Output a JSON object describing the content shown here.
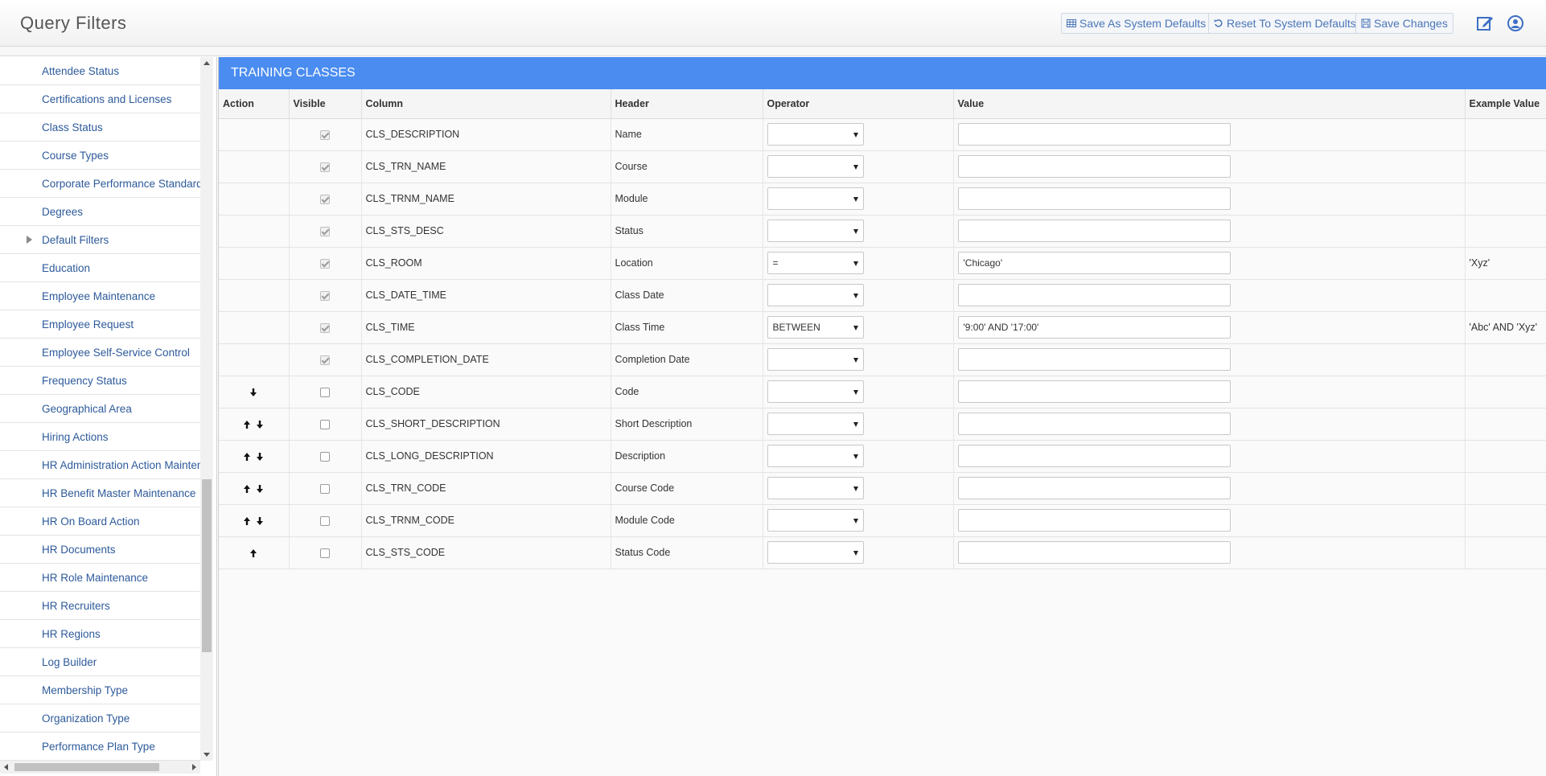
{
  "app": {
    "title": "Query Filters"
  },
  "header": {
    "buttons": [
      {
        "label": "Save As System Defaults",
        "icon": "table-icon"
      },
      {
        "label": "Reset To System Defaults",
        "icon": "undo-icon"
      },
      {
        "label": "Save Changes",
        "icon": "save-icon"
      }
    ],
    "icons": [
      "edit-icon",
      "user-icon"
    ],
    "accent": "#4a76b8"
  },
  "sidebar": {
    "items": [
      {
        "label": "Attendee Status"
      },
      {
        "label": "Certifications and Licenses"
      },
      {
        "label": "Class Status"
      },
      {
        "label": "Course Types"
      },
      {
        "label": "Corporate Performance Standards"
      },
      {
        "label": "Degrees"
      },
      {
        "label": "Default Filters",
        "expandable": true
      },
      {
        "label": "Education"
      },
      {
        "label": "Employee Maintenance"
      },
      {
        "label": "Employee Request"
      },
      {
        "label": "Employee Self-Service Control"
      },
      {
        "label": "Frequency Status"
      },
      {
        "label": "Geographical Area"
      },
      {
        "label": "Hiring Actions"
      },
      {
        "label": "HR Administration Action Maintena"
      },
      {
        "label": "HR Benefit Master Maintenance"
      },
      {
        "label": "HR On Board Action"
      },
      {
        "label": "HR Documents"
      },
      {
        "label": "HR Role Maintenance"
      },
      {
        "label": "HR Recruiters"
      },
      {
        "label": "HR Regions"
      },
      {
        "label": "Log Builder"
      },
      {
        "label": "Membership Type"
      },
      {
        "label": "Organization Type"
      },
      {
        "label": "Performance Plan Type"
      }
    ]
  },
  "main": {
    "panel_title": "TRAINING CLASSES",
    "panel_color": "#4a8cf0",
    "columns": [
      "Action",
      "Visible",
      "Column",
      "Header",
      "Operator",
      "Value",
      "Example Value"
    ],
    "rows": [
      {
        "actions": [],
        "visible": true,
        "column": "CLS_DESCRIPTION",
        "header": "Name",
        "operator": "",
        "value": "",
        "example": ""
      },
      {
        "actions": [],
        "visible": true,
        "column": "CLS_TRN_NAME",
        "header": "Course",
        "operator": "",
        "value": "",
        "example": ""
      },
      {
        "actions": [],
        "visible": true,
        "column": "CLS_TRNM_NAME",
        "header": "Module",
        "operator": "",
        "value": "",
        "example": ""
      },
      {
        "actions": [],
        "visible": true,
        "column": "CLS_STS_DESC",
        "header": "Status",
        "operator": "",
        "value": "",
        "example": ""
      },
      {
        "actions": [],
        "visible": true,
        "column": "CLS_ROOM",
        "header": "Location",
        "operator": "=",
        "value": "'Chicago'",
        "example": "'Xyz'"
      },
      {
        "actions": [],
        "visible": true,
        "column": "CLS_DATE_TIME",
        "header": "Class Date",
        "operator": "",
        "value": "",
        "example": ""
      },
      {
        "actions": [],
        "visible": true,
        "column": "CLS_TIME",
        "header": "Class Time",
        "operator": "BETWEEN",
        "value": "'9:00' AND '17:00'",
        "example": "'Abc' AND 'Xyz'"
      },
      {
        "actions": [],
        "visible": true,
        "column": "CLS_COMPLETION_DATE",
        "header": "Completion Date",
        "operator": "",
        "value": "",
        "example": ""
      },
      {
        "actions": [
          "down"
        ],
        "visible": false,
        "column": "CLS_CODE",
        "header": "Code",
        "operator": "",
        "value": "",
        "example": ""
      },
      {
        "actions": [
          "up",
          "down"
        ],
        "visible": false,
        "column": "CLS_SHORT_DESCRIPTION",
        "header": "Short Description",
        "operator": "",
        "value": "",
        "example": ""
      },
      {
        "actions": [
          "up",
          "down"
        ],
        "visible": false,
        "column": "CLS_LONG_DESCRIPTION",
        "header": "Description",
        "operator": "",
        "value": "",
        "example": ""
      },
      {
        "actions": [
          "up",
          "down"
        ],
        "visible": false,
        "column": "CLS_TRN_CODE",
        "header": "Course Code",
        "operator": "",
        "value": "",
        "example": ""
      },
      {
        "actions": [
          "up",
          "down"
        ],
        "visible": false,
        "column": "CLS_TRNM_CODE",
        "header": "Module Code",
        "operator": "",
        "value": "",
        "example": ""
      },
      {
        "actions": [
          "up"
        ],
        "visible": false,
        "column": "CLS_STS_CODE",
        "header": "Status Code",
        "operator": "",
        "value": "",
        "example": ""
      }
    ]
  }
}
